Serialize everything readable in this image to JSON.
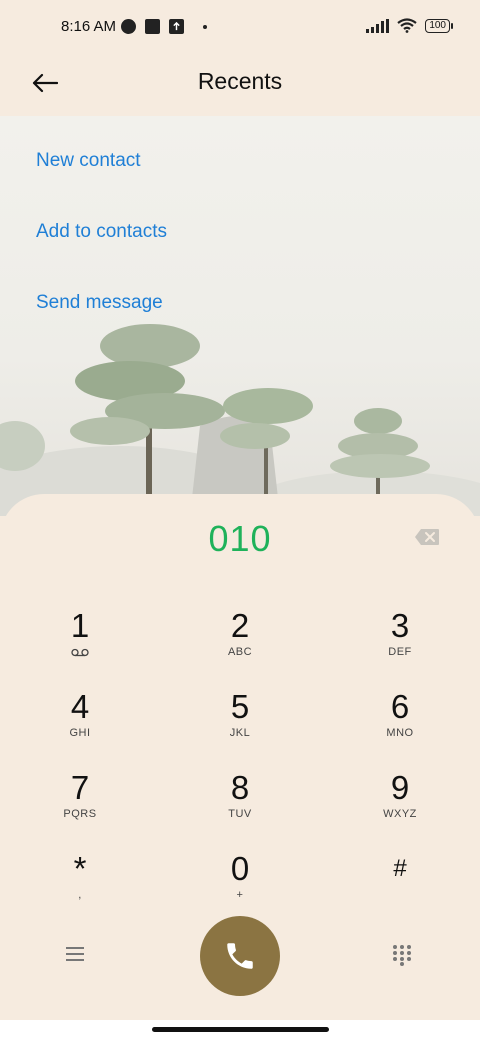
{
  "status_bar": {
    "time": "8:16 AM",
    "battery": "100"
  },
  "header": {
    "title": "Recents",
    "back_icon": "arrow-left-icon"
  },
  "actions": {
    "new_contact": "New contact",
    "add_to_contacts": "Add to contacts",
    "send_message": "Send message"
  },
  "dialer": {
    "number": "010",
    "keys": [
      {
        "digit": "1",
        "letters": ""
      },
      {
        "digit": "2",
        "letters": "ABC"
      },
      {
        "digit": "3",
        "letters": "DEF"
      },
      {
        "digit": "4",
        "letters": "GHI"
      },
      {
        "digit": "5",
        "letters": "JKL"
      },
      {
        "digit": "6",
        "letters": "MNO"
      },
      {
        "digit": "7",
        "letters": "PQRS"
      },
      {
        "digit": "8",
        "letters": "TUV"
      },
      {
        "digit": "9",
        "letters": "WXYZ"
      },
      {
        "digit": "*",
        "letters": ","
      },
      {
        "digit": "0",
        "letters": "+"
      },
      {
        "digit": "#",
        "letters": ""
      }
    ],
    "call_color": "#8b7442",
    "number_color": "#1fb25a"
  }
}
